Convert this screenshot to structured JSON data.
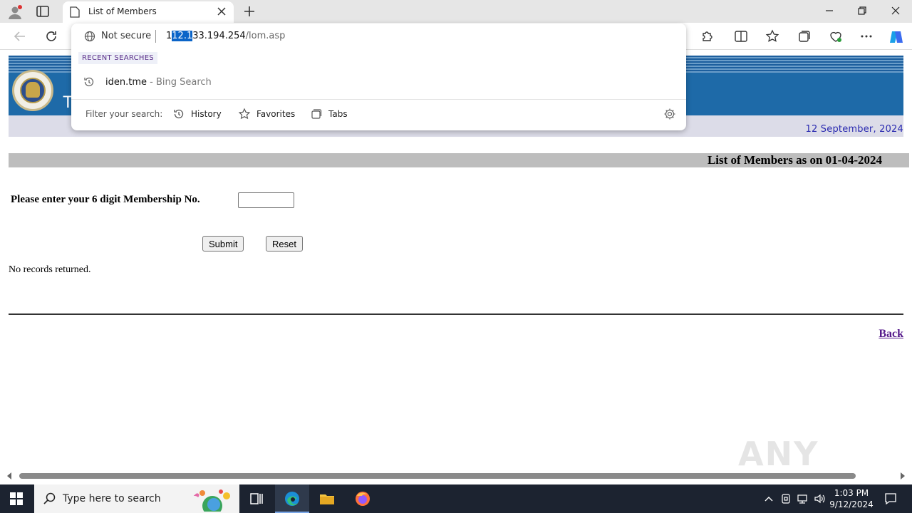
{
  "browser": {
    "tab_title": "List of Members",
    "address": {
      "security_label": "Not secure",
      "url_prefix": "1",
      "url_selected": "12.1",
      "url_host_rest": "33.194.254",
      "url_path": "/lom.asp"
    },
    "dropdown": {
      "recent_header": "RECENT SEARCHES",
      "recent_item_query": "iden.tme",
      "recent_item_source": " - Bing Search",
      "filter_label": "Filter your search:",
      "filters": [
        "History",
        "Favorites",
        "Tabs"
      ]
    }
  },
  "page": {
    "banner_letter": "T",
    "date": "12 September, 2024",
    "title": "List of Members as on 01-04-2024",
    "prompt": "Please enter your 6 digit Membership No.",
    "membership_value": "",
    "submit_label": "Submit",
    "reset_label": "Reset",
    "result_text": "No records returned.",
    "back_label": "Back"
  },
  "watermark": "ANY RUN",
  "taskbar": {
    "search_placeholder": "Type here to search",
    "time": "1:03 PM",
    "date": "9/12/2024"
  },
  "colors": {
    "banner_blue": "#1e6aa8",
    "date_text": "#2a2ab0",
    "link_visited": "#551a8b",
    "url_selection": "#0a64c8"
  }
}
